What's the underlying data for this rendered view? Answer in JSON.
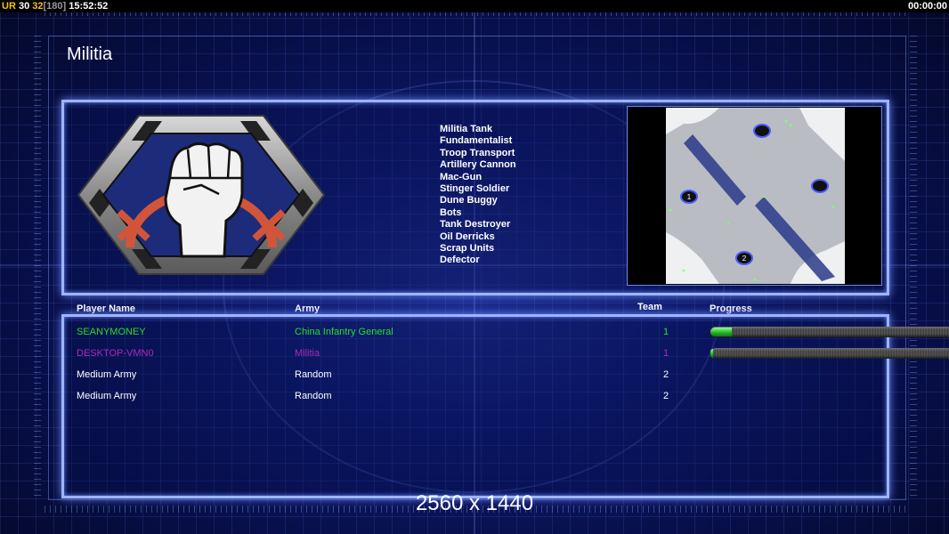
{
  "status_bar": {
    "ur": "UR",
    "val_a": "30",
    "val_b": "32",
    "val_c": "[180]",
    "clock": "15:52:52",
    "timer": "00:00:00"
  },
  "title": "Militia",
  "emblem": {
    "icon": "fist-emblem-icon"
  },
  "units": [
    "Militia Tank",
    "Fundamentalist",
    "Troop Transport",
    "Artillery Cannon",
    "Mac-Gun",
    "Stinger Soldier",
    "Dune Buggy",
    "Bots",
    "Tank Destroyer",
    "Oil Derricks",
    "Scrap Units",
    "Defector"
  ],
  "minimap": {
    "start_markers": [
      "1",
      "2"
    ]
  },
  "players_table": {
    "headers": {
      "name": "Player Name",
      "army": "Army",
      "team": "Team",
      "progress": "Progress"
    },
    "rows": [
      {
        "name": "SEANYMONEY",
        "army": "China Infantry General",
        "team": "1",
        "color": "#22e02a",
        "progress": 0.09
      },
      {
        "name": "DESKTOP-VMN0",
        "army": "Militia",
        "team": "1",
        "color": "#b02ab8",
        "progress": 0.01
      },
      {
        "name": "Medium Army",
        "army": "Random",
        "team": "2",
        "color": "#ffffff",
        "progress": null
      },
      {
        "name": "Medium Army",
        "army": "Random",
        "team": "2",
        "color": "#ffffff",
        "progress": null
      }
    ]
  },
  "resolution": "2560 x 1440",
  "colors": {
    "frame_glow": "#9fb4ff",
    "background": "#0c1766"
  }
}
